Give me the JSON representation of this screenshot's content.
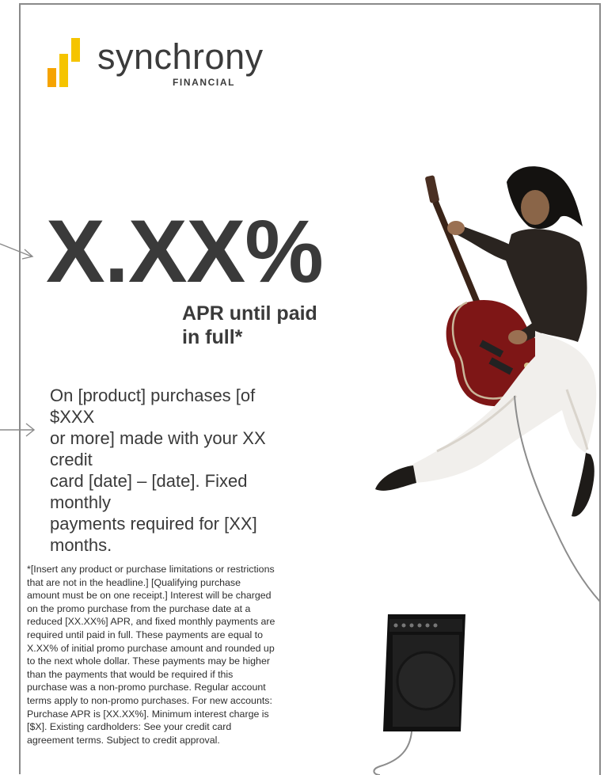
{
  "logo": {
    "wordmark": "synchrony",
    "subtext": "FINANCIAL",
    "colors": {
      "bar_yellow": "#f5c400",
      "bar_orange": "#f6a300",
      "text": "#3b3b3b"
    }
  },
  "headline": {
    "rate": "X.XX%",
    "line1": "APR until paid",
    "line2": "in full*"
  },
  "body": {
    "line1": "On [product] purchases [of $XXX",
    "line2": "or more] made with your XX credit",
    "line3": "card [date] – [date]. Fixed monthly",
    "line4": "payments required for [XX]",
    "line5": "months."
  },
  "disclaimer": {
    "lines": [
      "*[Insert any product or purchase limitations or restrictions",
      "that are not in the headline.]  [Qualifying purchase",
      "amount must be on one receipt.] Interest will be charged",
      "on the promo purchase from the purchase date at a",
      "reduced [XX.XX%] APR, and fixed monthly payments are",
      "required until paid in full. These payments are equal to",
      "X.XX% of initial promo purchase amount and rounded up",
      "to the next whole dollar. These payments may be higher",
      "than the payments that would be required if this",
      "purchase was a non-promo purchase. Regular account",
      "terms apply to non-promo purchases. For new accounts:",
      "Purchase APR is [XX.XX%]. Minimum interest charge is",
      "[$X]. Existing cardholders: See your credit card",
      "agreement terms. Subject to credit approval."
    ]
  },
  "illustration": {
    "subject": "jumping-guitarist-with-amplifier"
  }
}
